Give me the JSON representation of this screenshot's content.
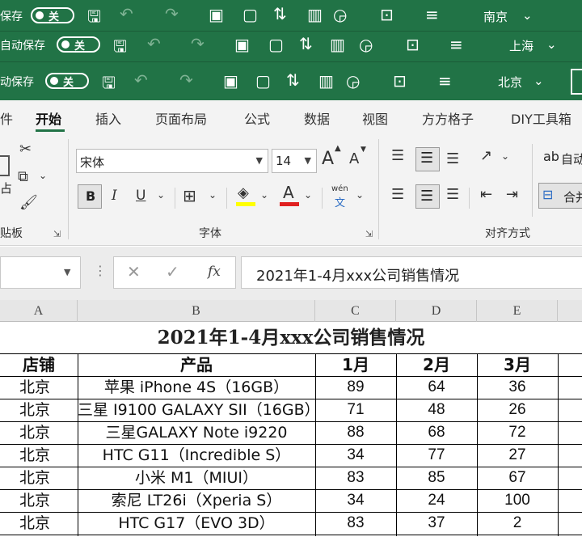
{
  "title_bars": [
    {
      "autosave_label": "保存",
      "toggle_label": "关",
      "location": "南京"
    },
    {
      "autosave_label": "自动保存",
      "toggle_label": "关",
      "location": "上海"
    },
    {
      "autosave_label": "动保存",
      "toggle_label": "关",
      "location": "北京"
    }
  ],
  "ribbon_tabs": [
    "件",
    "开始",
    "插入",
    "页面布局",
    "公式",
    "数据",
    "视图",
    "方方格子",
    "DIY工具箱"
  ],
  "active_tab": "开始",
  "ribbon": {
    "clipboard_label": "贴板",
    "paste_partial": "占",
    "font_group_label": "字体",
    "font_name": "宋体",
    "font_size": "14",
    "bold": "B",
    "italic": "I",
    "underline": "U",
    "grow_font": "A",
    "shrink_font": "A",
    "font_color_letter": "A",
    "phonetic_top": "wén",
    "phonetic_bottom": "文",
    "align_group_label": "对齐方式",
    "wrap_prefix": "ab",
    "wrap_label": "自动",
    "merge_label": "合并"
  },
  "formula_bar": {
    "cancel": "✕",
    "enter": "✓",
    "fx": "fx",
    "content": "2021年1-4月xxx公司销售情况"
  },
  "columns": [
    "A",
    "B",
    "C",
    "D",
    "E"
  ],
  "sheet": {
    "title": "2021年1-4月xxx公司销售情况",
    "headers": [
      "店铺",
      "产品",
      "1月",
      "2月",
      "3月"
    ],
    "rows": [
      [
        "北京",
        "苹果 iPhone 4S（16GB）",
        "89",
        "64",
        "36"
      ],
      [
        "北京",
        "三星 I9100 GALAXY SII（16GB）",
        "71",
        "48",
        "26"
      ],
      [
        "北京",
        "三星GALAXY Note i9220",
        "88",
        "68",
        "72"
      ],
      [
        "北京",
        "HTC G11（Incredible S）",
        "34",
        "77",
        "27"
      ],
      [
        "北京",
        "小米 M1（MIUI）",
        "83",
        "85",
        "67"
      ],
      [
        "北京",
        "索尼 LT26i（Xperia S）",
        "34",
        "24",
        "100"
      ],
      [
        "北京",
        "HTC G17（EVO 3D）",
        "83",
        "37",
        "2"
      ]
    ]
  },
  "colors": {
    "excel_green": "#217346",
    "ribbon_bg": "#f3f3f3",
    "font_color_bar": "#e02020",
    "highlight_bar": "#ffff00"
  }
}
